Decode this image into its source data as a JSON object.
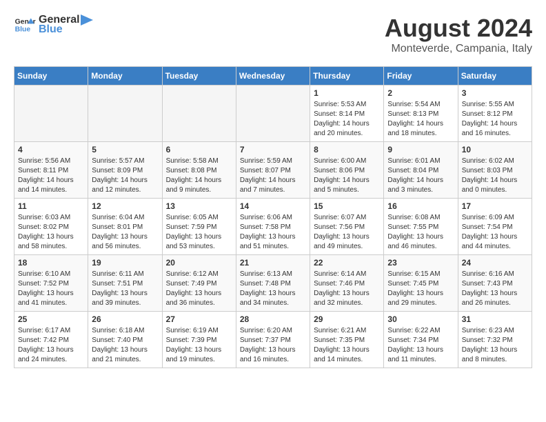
{
  "header": {
    "logo_general": "General",
    "logo_blue": "Blue",
    "month_year": "August 2024",
    "location": "Monteverde, Campania, Italy"
  },
  "days_of_week": [
    "Sunday",
    "Monday",
    "Tuesday",
    "Wednesday",
    "Thursday",
    "Friday",
    "Saturday"
  ],
  "weeks": [
    [
      {
        "day": "",
        "info": ""
      },
      {
        "day": "",
        "info": ""
      },
      {
        "day": "",
        "info": ""
      },
      {
        "day": "",
        "info": ""
      },
      {
        "day": "1",
        "info": "Sunrise: 5:53 AM\nSunset: 8:14 PM\nDaylight: 14 hours\nand 20 minutes."
      },
      {
        "day": "2",
        "info": "Sunrise: 5:54 AM\nSunset: 8:13 PM\nDaylight: 14 hours\nand 18 minutes."
      },
      {
        "day": "3",
        "info": "Sunrise: 5:55 AM\nSunset: 8:12 PM\nDaylight: 14 hours\nand 16 minutes."
      }
    ],
    [
      {
        "day": "4",
        "info": "Sunrise: 5:56 AM\nSunset: 8:11 PM\nDaylight: 14 hours\nand 14 minutes."
      },
      {
        "day": "5",
        "info": "Sunrise: 5:57 AM\nSunset: 8:09 PM\nDaylight: 14 hours\nand 12 minutes."
      },
      {
        "day": "6",
        "info": "Sunrise: 5:58 AM\nSunset: 8:08 PM\nDaylight: 14 hours\nand 9 minutes."
      },
      {
        "day": "7",
        "info": "Sunrise: 5:59 AM\nSunset: 8:07 PM\nDaylight: 14 hours\nand 7 minutes."
      },
      {
        "day": "8",
        "info": "Sunrise: 6:00 AM\nSunset: 8:06 PM\nDaylight: 14 hours\nand 5 minutes."
      },
      {
        "day": "9",
        "info": "Sunrise: 6:01 AM\nSunset: 8:04 PM\nDaylight: 14 hours\nand 3 minutes."
      },
      {
        "day": "10",
        "info": "Sunrise: 6:02 AM\nSunset: 8:03 PM\nDaylight: 14 hours\nand 0 minutes."
      }
    ],
    [
      {
        "day": "11",
        "info": "Sunrise: 6:03 AM\nSunset: 8:02 PM\nDaylight: 13 hours\nand 58 minutes."
      },
      {
        "day": "12",
        "info": "Sunrise: 6:04 AM\nSunset: 8:01 PM\nDaylight: 13 hours\nand 56 minutes."
      },
      {
        "day": "13",
        "info": "Sunrise: 6:05 AM\nSunset: 7:59 PM\nDaylight: 13 hours\nand 53 minutes."
      },
      {
        "day": "14",
        "info": "Sunrise: 6:06 AM\nSunset: 7:58 PM\nDaylight: 13 hours\nand 51 minutes."
      },
      {
        "day": "15",
        "info": "Sunrise: 6:07 AM\nSunset: 7:56 PM\nDaylight: 13 hours\nand 49 minutes."
      },
      {
        "day": "16",
        "info": "Sunrise: 6:08 AM\nSunset: 7:55 PM\nDaylight: 13 hours\nand 46 minutes."
      },
      {
        "day": "17",
        "info": "Sunrise: 6:09 AM\nSunset: 7:54 PM\nDaylight: 13 hours\nand 44 minutes."
      }
    ],
    [
      {
        "day": "18",
        "info": "Sunrise: 6:10 AM\nSunset: 7:52 PM\nDaylight: 13 hours\nand 41 minutes."
      },
      {
        "day": "19",
        "info": "Sunrise: 6:11 AM\nSunset: 7:51 PM\nDaylight: 13 hours\nand 39 minutes."
      },
      {
        "day": "20",
        "info": "Sunrise: 6:12 AM\nSunset: 7:49 PM\nDaylight: 13 hours\nand 36 minutes."
      },
      {
        "day": "21",
        "info": "Sunrise: 6:13 AM\nSunset: 7:48 PM\nDaylight: 13 hours\nand 34 minutes."
      },
      {
        "day": "22",
        "info": "Sunrise: 6:14 AM\nSunset: 7:46 PM\nDaylight: 13 hours\nand 32 minutes."
      },
      {
        "day": "23",
        "info": "Sunrise: 6:15 AM\nSunset: 7:45 PM\nDaylight: 13 hours\nand 29 minutes."
      },
      {
        "day": "24",
        "info": "Sunrise: 6:16 AM\nSunset: 7:43 PM\nDaylight: 13 hours\nand 26 minutes."
      }
    ],
    [
      {
        "day": "25",
        "info": "Sunrise: 6:17 AM\nSunset: 7:42 PM\nDaylight: 13 hours\nand 24 minutes."
      },
      {
        "day": "26",
        "info": "Sunrise: 6:18 AM\nSunset: 7:40 PM\nDaylight: 13 hours\nand 21 minutes."
      },
      {
        "day": "27",
        "info": "Sunrise: 6:19 AM\nSunset: 7:39 PM\nDaylight: 13 hours\nand 19 minutes."
      },
      {
        "day": "28",
        "info": "Sunrise: 6:20 AM\nSunset: 7:37 PM\nDaylight: 13 hours\nand 16 minutes."
      },
      {
        "day": "29",
        "info": "Sunrise: 6:21 AM\nSunset: 7:35 PM\nDaylight: 13 hours\nand 14 minutes."
      },
      {
        "day": "30",
        "info": "Sunrise: 6:22 AM\nSunset: 7:34 PM\nDaylight: 13 hours\nand 11 minutes."
      },
      {
        "day": "31",
        "info": "Sunrise: 6:23 AM\nSunset: 7:32 PM\nDaylight: 13 hours\nand 8 minutes."
      }
    ]
  ]
}
